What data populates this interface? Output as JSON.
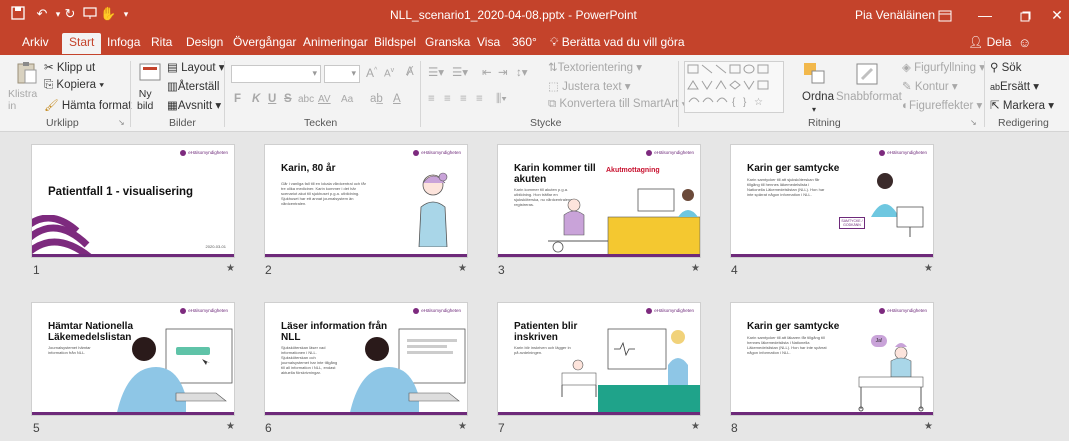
{
  "titlebar": {
    "title": "NLL_scenario1_2020-04-08.pptx  -  PowerPoint",
    "user": "Pia Venäläinen",
    "icons": [
      "save-icon",
      "undo-icon",
      "redo-icon",
      "present-icon",
      "touch-mode-icon",
      "customize-icon"
    ],
    "window_buttons": [
      "ribbon-display-icon",
      "minimize-icon",
      "maximize-icon",
      "close-icon"
    ]
  },
  "tabs": {
    "items": [
      "Arkiv",
      "Start",
      "Infoga",
      "Rita",
      "Design",
      "Övergångar",
      "Animeringar",
      "Bildspel",
      "Granska",
      "Visa",
      "360°"
    ],
    "active": "Start",
    "tell_me": "Berätta vad du vill göra",
    "share": "Dela"
  },
  "ribbon": {
    "clipboard": {
      "paste": "Klistra\nin",
      "cut": "Klipp ut",
      "copy": "Kopiera",
      "format_painter": "Hämta format",
      "label": "Urklipp"
    },
    "slides": {
      "new_slide": "Ny\nbild",
      "layout": "Layout",
      "reset": "Återställ",
      "section": "Avsnitt",
      "label": "Bilder"
    },
    "font": {
      "bold": "F",
      "italic": "K",
      "underline": "U",
      "strike": "S",
      "shadow": "abc",
      "spacing": "AV",
      "case": "Aa",
      "label": "Tecken"
    },
    "paragraph": {
      "text_direction": "Textorientering",
      "align_text": "Justera text",
      "smartart": "Konvertera till SmartArt",
      "label": "Stycke"
    },
    "drawing": {
      "arrange": "Ordna",
      "quick_styles": "Snabbformat",
      "shape_fill": "Figurfyllning",
      "shape_outline": "Kontur",
      "shape_effects": "Figureffekter",
      "label": "Ritning"
    },
    "editing": {
      "find": "Sök",
      "replace": "Ersätt",
      "select": "Markera",
      "label": "Redigering"
    }
  },
  "slides": [
    {
      "number": "1",
      "title": "Patientfall 1 - visualisering",
      "body": "",
      "date": "2020-03-01",
      "footer": "",
      "logo": "eHälsomyndigheten"
    },
    {
      "number": "2",
      "title": "Karin, 80 år",
      "body": "Går i vanliga fall till en lokala vårdcentral och får tre olika mediciner. Karin kommer i det här scenariot akut till sjukhuset p.g.a. utbildning. Sjukhuset har ett annat journalsystem än vårdcentralen.",
      "date": "",
      "footer": "",
      "logo": "eHälsomyndigheten"
    },
    {
      "number": "3",
      "title": "Karin kommer till akuten",
      "body": "Karin kommer till akuten p.g.a. utbildning. Hon träffar en sjuksköterska, nu vårdcentralens registreras.",
      "date": "",
      "footer": "",
      "logo": "eHälsomyndigheten",
      "sign": "Akutmottagning"
    },
    {
      "number": "4",
      "title": "Karin ger samtycke",
      "body": "Karin samtycker till att sjuksköterskan får tillgång till hennes läkemedelslista i Nationella Läkemedelslistan (NLL). Hon har inte spärrat någon information i NLL.",
      "date": "",
      "footer": "",
      "logo": "eHälsomyndigheten",
      "sign": "SAMTYCKE / GODKÄNN"
    },
    {
      "number": "5",
      "title": "Hämtar Nationella Läkemedelslistan",
      "body": "Journalsystemet hämtar information från NLL.",
      "date": "",
      "footer": "",
      "logo": "eHälsomyndigheten"
    },
    {
      "number": "6",
      "title": "Läser information från NLL",
      "body": "Sjuksköterskan läser vad informationen i NLL. Sjuksköterskan och journalsystemet har inte tillgång till all information i NLL, endast aktuella förskrivningar.",
      "date": "",
      "footer": "",
      "logo": "eHälsomyndigheten"
    },
    {
      "number": "7",
      "title": "Patienten blir inskriven",
      "body": "Karin blir inskriven och lägger in på avdelningen.",
      "date": "",
      "footer": "",
      "logo": "eHälsomyndigheten"
    },
    {
      "number": "8",
      "title": "Karin ger samtycke",
      "body": "Karin samtycker till att läkaren får tillgång till hennes läkemedelslista i Nationella Läkemedelslistan (NLL). Hon har inte spärrat någon information i NLL.",
      "date": "",
      "footer": "",
      "logo": "eHälsomyndigheten",
      "bubble": "Ja!"
    }
  ],
  "colors": {
    "accent": "#c4432b",
    "purple": "#6e2a7a",
    "ribbon_bg": "#f3f3f3",
    "sorter_bg": "#e6e6e6"
  }
}
